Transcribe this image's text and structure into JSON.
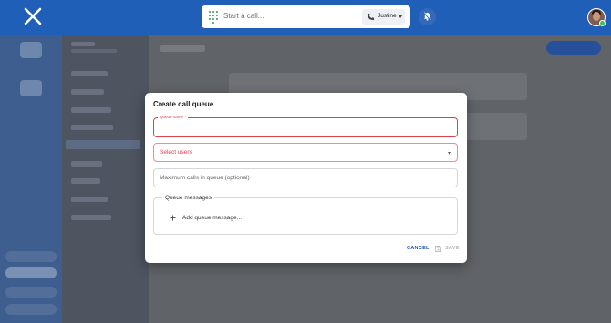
{
  "topbar": {
    "call_placeholder": "Start a call...",
    "caller_id": "Justine",
    "logo_icon": "x-logo-icon",
    "dialpad_icon": "dialpad-icon",
    "phone_icon": "phone-icon",
    "dnd_icon": "bell-off-icon",
    "accent_color": "#1f5fb8",
    "dialpad_color": "#2e9e4f",
    "presence": "online"
  },
  "modal": {
    "title": "Create call queue",
    "name_label": "Queue name *",
    "users_placeholder": "Select users",
    "max_calls_placeholder": "Maximum calls in queue (optional)",
    "messages_legend": "Queue messages",
    "add_message_label": "Add queue message...",
    "cancel_label": "CANCEL",
    "save_label": "SAVE",
    "error_color": "#e0424c",
    "primary_color": "#2a56a8"
  }
}
